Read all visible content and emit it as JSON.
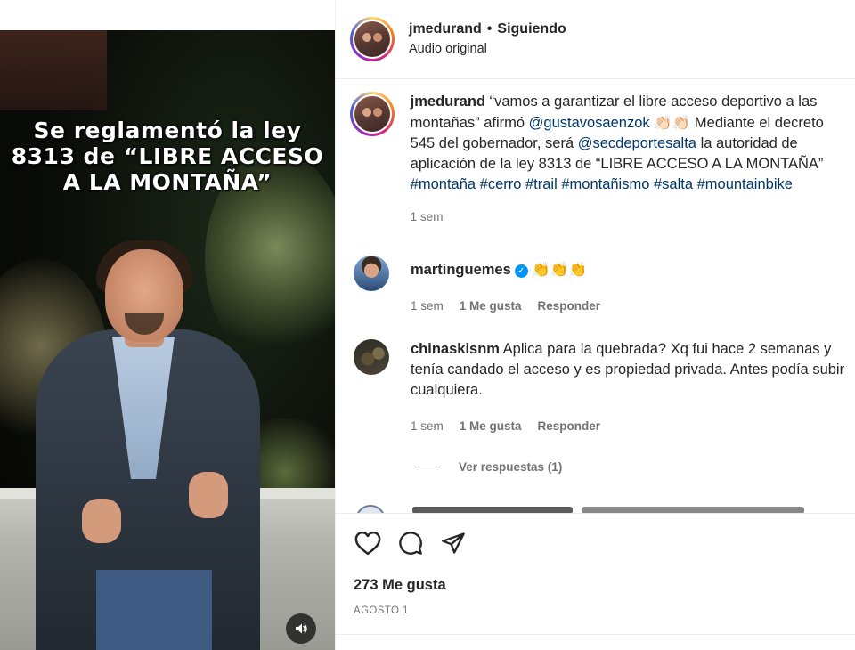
{
  "media": {
    "overlay_text": "Se reglamentó la ley\n8313 de “LIBRE ACCESO\nA LA MONTAÑA”",
    "audio_icon": "speaker-icon"
  },
  "header": {
    "username": "jmedurand",
    "separator": "•",
    "follow_status": "Siguiendo",
    "audio_label": "Audio original"
  },
  "caption": {
    "username": "jmedurand",
    "text_1": "“vamos a garantizar el libre acceso deportivo a las montañas” afirmó ",
    "mention_1": "@gustavosaenzok",
    "claps_1": "👏🏻👏🏻",
    "text_2": " Mediante el decreto 545 del gobernador, será ",
    "mention_2": "@secdeportesalta",
    "text_3": " la autoridad de aplicación de la ley 8313 de “LIBRE ACCESO A LA MONTAÑA” ",
    "hashtags": "#montaña #cerro #trail #montañismo #salta #mountainbike",
    "time": "1 sem"
  },
  "comments": [
    {
      "username": "martinguemes",
      "verified": true,
      "text": "👏👏👏",
      "time": "1 sem",
      "likes": "1 Me gusta",
      "reply": "Responder"
    },
    {
      "username": "chinaskisnm",
      "verified": false,
      "text": " Aplica para la quebrada? Xq fui hace 2 semanas y tenía candado el acceso y es propiedad privada. Antes podía subir cualquiera.",
      "time": "1 sem",
      "likes": "1 Me gusta",
      "reply": "Responder"
    }
  ],
  "view_replies": "Ver respuestas (1)",
  "actions": {
    "like_icon": "heart-icon",
    "comment_icon": "comment-icon",
    "share_icon": "share-icon"
  },
  "likes_count": "273 Me gusta",
  "date": "AGOSTO 1",
  "colors": {
    "link": "#00376b",
    "secondary": "#737373",
    "verified": "#0095f6"
  }
}
